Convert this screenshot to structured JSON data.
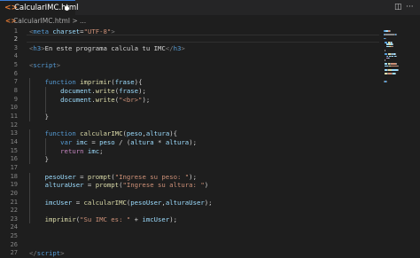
{
  "tab": {
    "label": "CalcularIMC.html",
    "icon": "html5-icon",
    "dirty": true
  },
  "toolbar": {
    "split_icon": "split-editor-icon",
    "more_icon": "more-actions-icon",
    "split_glyph": "◫",
    "more_glyph": "···"
  },
  "breadcrumb": {
    "file": "CalcularIMC.html",
    "separator": ">",
    "symbol": "..."
  },
  "colors": {
    "tag": "#569cd6",
    "attribute": "#9cdcfe",
    "string": "#ce9178",
    "keyword": "#569cd6",
    "function": "#dcdcaa",
    "control": "#c586c0",
    "text": "#d4d4d4"
  },
  "editor": {
    "active_line": 2,
    "lines": [
      {
        "n": "1",
        "tokens": [
          [
            "br",
            "<"
          ],
          [
            "tag",
            "meta"
          ],
          [
            "t",
            " "
          ],
          [
            "attr",
            "charset"
          ],
          [
            "t",
            "="
          ],
          [
            "str",
            "\"UTF-8\""
          ],
          [
            "br",
            ">"
          ]
        ]
      },
      {
        "n": "2",
        "tokens": []
      },
      {
        "n": "3",
        "tokens": [
          [
            "br",
            "<"
          ],
          [
            "tag",
            "h3"
          ],
          [
            "br",
            ">"
          ],
          [
            "t",
            "En este programa calcula tu IMC"
          ],
          [
            "br",
            "</"
          ],
          [
            "tag",
            "h3"
          ],
          [
            "br",
            ">"
          ]
        ]
      },
      {
        "n": "4",
        "tokens": []
      },
      {
        "n": "5",
        "tokens": [
          [
            "br",
            "<"
          ],
          [
            "tag",
            "script"
          ],
          [
            "br",
            ">"
          ]
        ]
      },
      {
        "n": "6",
        "tokens": []
      },
      {
        "n": "7",
        "tokens": [
          [
            "t",
            "    "
          ],
          [
            "kw",
            "function"
          ],
          [
            "t",
            " "
          ],
          [
            "fn",
            "imprimir"
          ],
          [
            "t",
            "("
          ],
          [
            "var",
            "frase"
          ],
          [
            "t",
            "){"
          ]
        ]
      },
      {
        "n": "8",
        "tokens": [
          [
            "t",
            "        "
          ],
          [
            "var",
            "document"
          ],
          [
            "t",
            "."
          ],
          [
            "fn",
            "write"
          ],
          [
            "t",
            "("
          ],
          [
            "var",
            "frase"
          ],
          [
            "t",
            ");"
          ]
        ]
      },
      {
        "n": "9",
        "tokens": [
          [
            "t",
            "        "
          ],
          [
            "var",
            "document"
          ],
          [
            "t",
            "."
          ],
          [
            "fn",
            "write"
          ],
          [
            "t",
            "("
          ],
          [
            "str",
            "\"<br>\""
          ],
          [
            "t",
            ");"
          ]
        ]
      },
      {
        "n": "10",
        "tokens": []
      },
      {
        "n": "11",
        "tokens": [
          [
            "t",
            "    }"
          ]
        ]
      },
      {
        "n": "12",
        "tokens": []
      },
      {
        "n": "13",
        "tokens": [
          [
            "t",
            "    "
          ],
          [
            "kw",
            "function"
          ],
          [
            "t",
            " "
          ],
          [
            "fn",
            "calcularIMC"
          ],
          [
            "t",
            "("
          ],
          [
            "var",
            "peso"
          ],
          [
            "t",
            ","
          ],
          [
            "var",
            "altura"
          ],
          [
            "t",
            "){"
          ]
        ]
      },
      {
        "n": "14",
        "tokens": [
          [
            "t",
            "        "
          ],
          [
            "kw",
            "var"
          ],
          [
            "t",
            " "
          ],
          [
            "var",
            "imc"
          ],
          [
            "t",
            " = "
          ],
          [
            "var",
            "peso"
          ],
          [
            "t",
            " / ("
          ],
          [
            "var",
            "altura"
          ],
          [
            "t",
            " * "
          ],
          [
            "var",
            "altura"
          ],
          [
            "t",
            ");"
          ]
        ]
      },
      {
        "n": "15",
        "tokens": [
          [
            "t",
            "        "
          ],
          [
            "ctl",
            "return"
          ],
          [
            "t",
            " "
          ],
          [
            "var",
            "imc"
          ],
          [
            "t",
            ";"
          ]
        ]
      },
      {
        "n": "16",
        "tokens": [
          [
            "t",
            "    }"
          ]
        ]
      },
      {
        "n": "17",
        "tokens": []
      },
      {
        "n": "18",
        "tokens": [
          [
            "t",
            "    "
          ],
          [
            "var",
            "pesoUser"
          ],
          [
            "t",
            " = "
          ],
          [
            "fn",
            "prompt"
          ],
          [
            "t",
            "("
          ],
          [
            "str",
            "\"Ingrese su peso: \""
          ],
          [
            "t",
            ");"
          ]
        ]
      },
      {
        "n": "19",
        "tokens": [
          [
            "t",
            "    "
          ],
          [
            "var",
            "alturaUser"
          ],
          [
            "t",
            " = "
          ],
          [
            "fn",
            "prompt"
          ],
          [
            "t",
            "("
          ],
          [
            "str",
            "\"Ingrese su altura: \""
          ],
          [
            "t",
            ")"
          ]
        ]
      },
      {
        "n": "20",
        "tokens": []
      },
      {
        "n": "21",
        "tokens": [
          [
            "t",
            "    "
          ],
          [
            "var",
            "imcUser"
          ],
          [
            "t",
            " = "
          ],
          [
            "fn",
            "calcularIMC"
          ],
          [
            "t",
            "("
          ],
          [
            "var",
            "pesoUser"
          ],
          [
            "t",
            ","
          ],
          [
            "var",
            "alturaUser"
          ],
          [
            "t",
            ");"
          ]
        ]
      },
      {
        "n": "22",
        "tokens": []
      },
      {
        "n": "23",
        "tokens": [
          [
            "t",
            "    "
          ],
          [
            "fn",
            "imprimir"
          ],
          [
            "t",
            "("
          ],
          [
            "str",
            "\"Su IMC es: \""
          ],
          [
            "t",
            " + "
          ],
          [
            "var",
            "imcUser"
          ],
          [
            "t",
            ");"
          ]
        ]
      },
      {
        "n": "24",
        "tokens": []
      },
      {
        "n": "25",
        "tokens": []
      },
      {
        "n": "26",
        "tokens": []
      },
      {
        "n": "27",
        "tokens": [
          [
            "br",
            "</"
          ],
          [
            "tag",
            "script"
          ],
          [
            "br",
            ">"
          ]
        ]
      }
    ]
  }
}
